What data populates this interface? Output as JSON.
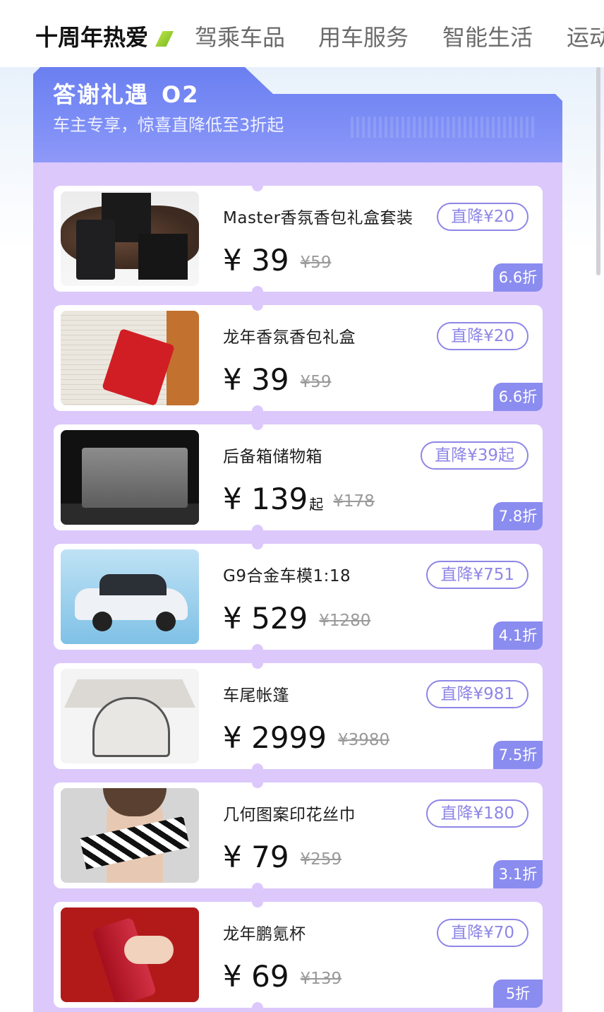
{
  "top_tabs": [
    {
      "label": "十周年热爱",
      "active": true
    },
    {
      "label": "驾乘车品",
      "active": false
    },
    {
      "label": "用车服务",
      "active": false
    },
    {
      "label": "智能生活",
      "active": false
    },
    {
      "label": "运动",
      "active": false
    }
  ],
  "section": {
    "title": "答谢礼遇",
    "number": "O2",
    "subtitle": "车主专享，惊喜直降低至3折起"
  },
  "currency": "¥",
  "products": [
    {
      "name": "Master香氛香包礼盒套装",
      "badge": "直降¥20",
      "price": "39",
      "price_suffix": "",
      "original": "¥59",
      "discount": "6.6折",
      "image": "fragrance-gift-set-image"
    },
    {
      "name": "龙年香氛香包礼盒",
      "badge": "直降¥20",
      "price": "39",
      "price_suffix": "",
      "original": "¥59",
      "discount": "6.6折",
      "image": "red-sachet-image"
    },
    {
      "name": "后备箱储物箱",
      "badge": "直降¥39起",
      "price": "139",
      "price_suffix": "起",
      "original": "¥178",
      "discount": "7.8折",
      "image": "trunk-storage-box-image"
    },
    {
      "name": "G9合金车模1:18",
      "badge": "直降¥751",
      "price": "529",
      "price_suffix": "",
      "original": "¥1280",
      "discount": "4.1折",
      "image": "g9-car-model-image"
    },
    {
      "name": "车尾帐篷",
      "badge": "直降¥981",
      "price": "2999",
      "price_suffix": "",
      "original": "¥3980",
      "discount": "7.5折",
      "image": "car-tail-tent-image"
    },
    {
      "name": "几何图案印花丝巾",
      "badge": "直降¥180",
      "price": "79",
      "price_suffix": "",
      "original": "¥259",
      "discount": "3.1折",
      "image": "silk-scarf-image"
    },
    {
      "name": "龙年鹏氪杯",
      "badge": "直降¥70",
      "price": "69",
      "price_suffix": "",
      "original": "¥139",
      "discount": "5折",
      "image": "red-thermos-cup-image"
    }
  ],
  "colors": {
    "accent": "#8e86e6",
    "list_background": "#dcc8fb",
    "header_gradient_start": "#6b7ff0",
    "discount_tag": "#8a8cef"
  }
}
